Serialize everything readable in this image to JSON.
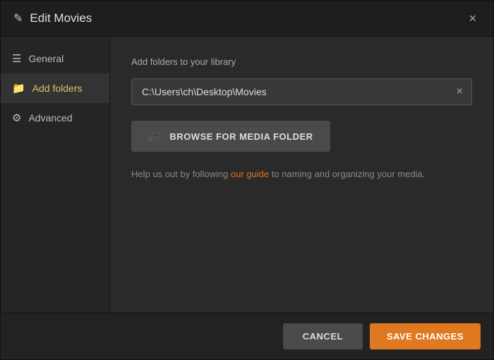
{
  "dialog": {
    "title": "Edit Movies",
    "close_label": "×"
  },
  "sidebar": {
    "items": [
      {
        "id": "general",
        "label": "General",
        "icon": "hamburger",
        "active": false
      },
      {
        "id": "add-folders",
        "label": "Add folders",
        "icon": "folder",
        "active": true
      },
      {
        "id": "advanced",
        "label": "Advanced",
        "icon": "gear",
        "active": false
      }
    ]
  },
  "content": {
    "section_label": "Add folders to your library",
    "folder_path": "C:\\Users\\ch\\Desktop\\Movies",
    "clear_button_label": "×",
    "browse_button_label": "BROWSE FOR MEDIA FOLDER",
    "help_text_before": "Help us out by following ",
    "help_link_text": "our guide",
    "help_text_after": " to naming and organizing your media."
  },
  "footer": {
    "cancel_label": "CANCEL",
    "save_label": "SAVE CHANGES"
  }
}
